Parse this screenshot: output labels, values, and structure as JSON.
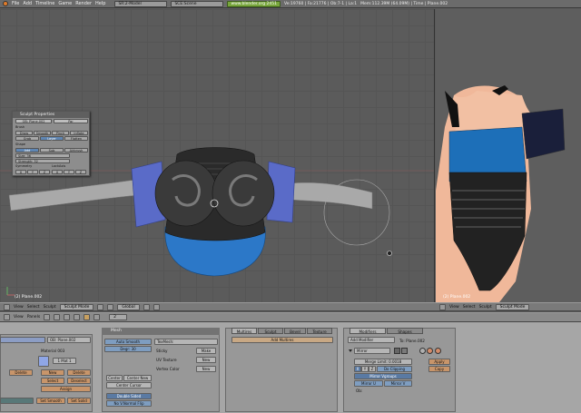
{
  "topbar": {
    "menus": [
      "File",
      "Add",
      "Timeline",
      "Game",
      "Render",
      "Help"
    ],
    "screen": "SR:2-Model",
    "scene": "SCE:Scene",
    "url": "www.blender.org 2451",
    "stats": "Ve:19760 | Fa:21776 | Ob:7-1 | La:1",
    "mem": "Mem:112.39M (64.09M) | Time | Plane.002"
  },
  "viewport_left": {
    "label": "(2) Plane.002",
    "header": {
      "menus": [
        "View",
        "Select",
        "Sculpt"
      ],
      "mode": "Sculpt Mode",
      "pivot": "Global"
    }
  },
  "viewport_right": {
    "label": "(2) Plane.002",
    "header": {
      "menus": [
        "View",
        "Select",
        "Sculpt"
      ],
      "mode": "Sculpt Mode"
    }
  },
  "sculpt_panel": {
    "title": "Sculpt Properties",
    "ob": "OB: Plane.002",
    "par": "Par",
    "brush_label": "Brush",
    "brushes_row1": [
      "Draw",
      "Smooth",
      "Pinch",
      "Inflate"
    ],
    "brushes_row2": [
      "Grab",
      "Layer",
      "Flatten"
    ],
    "shape_label": "Shape",
    "shape": [
      "Add",
      "Sub",
      "Airbrush"
    ],
    "size": "Size: 36",
    "strength": "Strength: 32",
    "symmetry_label": "Symmetry",
    "lock_label": "LockAxis",
    "axes": [
      "X",
      "Y",
      "Z"
    ]
  },
  "buttons_header": {
    "menus": [
      "View",
      "Panels"
    ],
    "frame": "2"
  },
  "link_panel": {
    "ob": "OB: Plane.002",
    "material": "Material 003",
    "mat_count": "1 Mat 1",
    "buttons": [
      "Delete",
      "New",
      "Delete",
      "Select",
      "Deselect",
      "Assign"
    ],
    "set_smooth": "Set Smooth",
    "set_solid": "Set Solid"
  },
  "mesh_panel": {
    "tab": "Mesh",
    "auto_smooth": "Auto Smooth",
    "degr": "Degr: 30",
    "texmesh": "TexMesh:",
    "sticky": "Sticky",
    "uv_texture": "UV Texture",
    "vertex_color": "Vertex Color",
    "make": "Make",
    "new1": "New",
    "new2": "New",
    "center": "Center",
    "center_new": "Center New",
    "center_cursor": "Center Cursor",
    "double_sided": "Double Sided",
    "no_v_normal_flip": "No V.Normal Flip"
  },
  "multires_panel": {
    "tabs": [
      "Multires",
      "Sculpt",
      "Bevel",
      "Texture"
    ],
    "add": "Add Multires"
  },
  "modifiers_panel": {
    "tabs": [
      "Modifiers",
      "Shapes"
    ],
    "add_modifier": "Add Modifier",
    "to": "To: Plane.002",
    "modifier_name": "Mirror",
    "merge_limit": "Merge Limit: 0.0018",
    "axes": [
      "X",
      "Y",
      "Z"
    ],
    "do_clipping": "Do Clipping",
    "mirror_vgroups": "Mirror Vgroups",
    "mirror_u": "Mirror U",
    "mirror_v": "Mirror V",
    "ob": "Ob:",
    "apply": "Apply",
    "copy": "Copy"
  }
}
